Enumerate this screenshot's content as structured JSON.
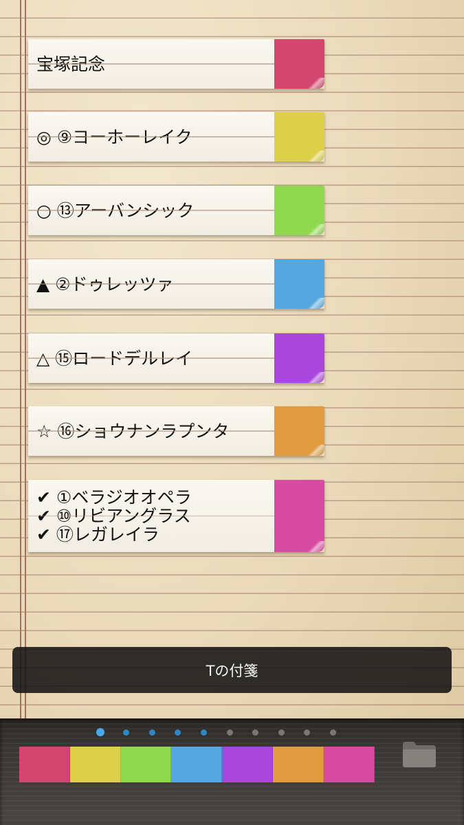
{
  "notes": [
    {
      "lines": [
        "宝塚記念"
      ],
      "color": "#d3466f"
    },
    {
      "lines": [
        "◎ ⑨ヨーホーレイク"
      ],
      "color": "#dccf4a"
    },
    {
      "lines": [
        "○ ⑬アーバンシック"
      ],
      "color": "#90d84e"
    },
    {
      "lines": [
        "▲ ②ドゥレッツァ"
      ],
      "color": "#55a7e0"
    },
    {
      "lines": [
        "△ ⑮ロードデルレイ"
      ],
      "color": "#a946db"
    },
    {
      "lines": [
        "☆ ⑯ショウナンラプンタ"
      ],
      "color": "#e09b3f"
    },
    {
      "lines": [
        "✔ ①ベラジオオペラ",
        "✔ ⑩リビアングラス",
        "✔ ⑰レガレイラ"
      ],
      "color": "#d84ba3"
    }
  ],
  "toast": {
    "text": "Tの付箋"
  },
  "pager": {
    "count": 10,
    "active": 0,
    "colors": {
      "active": "#4aa8ec",
      "highlighted": "#2f86c4",
      "inactive": "#7a7672"
    },
    "highlighted": [
      1,
      2,
      3,
      4
    ]
  },
  "palette": [
    "#d3466f",
    "#dccf4a",
    "#90d84e",
    "#55a7e0",
    "#a946db",
    "#e09b3f",
    "#d84ba3"
  ],
  "folder_icon": "folder-icon"
}
